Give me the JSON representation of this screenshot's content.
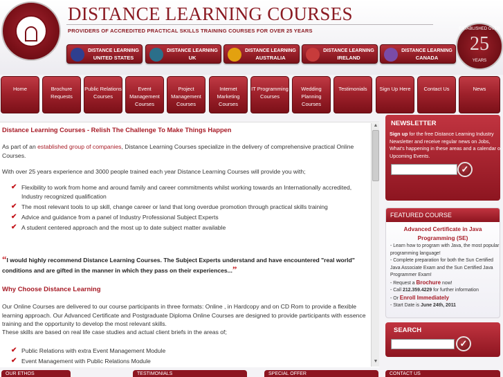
{
  "header": {
    "title": "DISTANCE LEARNING COURSES",
    "tagline": "PROVIDERS OF ACCREDITED PRACTICAL SKILLS TRAINING COURSES FOR OVER 25 YEARS",
    "logo_left_text": "DISTANCE LEARNING COURSES",
    "logo_right": {
      "est": "ESTABLISHED OVER",
      "number": "25",
      "years": "YEARS"
    }
  },
  "regions": [
    {
      "l1": "DISTANCE LEARNING",
      "l2": "UNITED STATES",
      "flag": "us-flag-icon",
      "color": "#2f3f8f"
    },
    {
      "l1": "DISTANCE LEARNING",
      "l2": "UK",
      "flag": "uk-flag-icon",
      "color": "#2b6f8a"
    },
    {
      "l1": "DISTANCE LEARNING",
      "l2": "AUSTRALIA",
      "flag": "australia-flag-icon",
      "color": "#e3a10f"
    },
    {
      "l1": "DISTANCE LEARNING",
      "l2": "IRELAND",
      "flag": "ireland-flag-icon",
      "color": "#c73b3b"
    },
    {
      "l1": "DISTANCE LEARNING",
      "l2": "CANADA",
      "flag": "canada-flag-icon",
      "color": "#7a4ba6"
    }
  ],
  "nav": [
    {
      "label": "Home"
    },
    {
      "label": "Brochure Requests"
    },
    {
      "label": "Public Relations Courses"
    },
    {
      "label": "Event Management Courses"
    },
    {
      "label": "Project Management Courses"
    },
    {
      "label": "Internet Marketing Courses"
    },
    {
      "label": "IT Programming Courses"
    },
    {
      "label": "Wedding Planning Courses"
    },
    {
      "label": "Testimonials"
    },
    {
      "label": "Sign Up Here"
    },
    {
      "label": "Contact Us"
    },
    {
      "label": "News"
    }
  ],
  "main": {
    "heading": "Distance Learning Courses - Relish The Challenge To Make Things Happen",
    "intro_pre": "As part of an ",
    "intro_link": "established group of companies",
    "intro_post": ", Distance Learning Courses specialize in the delivery of comprehensive practical Online Courses.",
    "experience": "With over 25 years experience and 3000 people trained each year Distance Learning Courses will provide you with;",
    "benefits": [
      "Flexibility to work from home and around family and career commitments whilst working towards an Internationally accredited, Industry recognized qualification",
      "The most relevant tools to up skill, change career or land that long overdue promotion through practical skills training",
      "Advice and guidance from a panel of Industry Professional Subject Experts",
      "A student centered approach and the most up to date subject matter available"
    ],
    "quote": "I would highly recommend Distance Learning Courses. The Subject Experts understand and have encountered \"real world\" conditions and are gifted in the manner in which they pass on their experiences...",
    "why_heading": "Why Choose Distance Learning",
    "why_text": "Our Online Courses are delivered to our course participants in three formats: Online , in Hardcopy and on CD Rom to provide a flexible learning approach. Our Advanced Certificate and Postgraduate Diploma Online Courses are designed to provide participants with essence training and the opportunity to develop the most relevant skills.",
    "why_text2": "These skills are based on real life case studies and actual client briefs in the areas of;",
    "areas": [
      "Public Relations with extra Event Management Module",
      "Event Management with Public Relations Module"
    ]
  },
  "sidebar": {
    "newsletter": {
      "heading": "NEWSLETTER",
      "lead": "Sign up",
      "text": " for the free Distance Learning Industry Newsletter and receive regular news on Jobs, What's happening in these areas and a calendar of Upcoming Events."
    },
    "featured": {
      "heading": "FEATURED COURSE",
      "title": "Advanced Certificate in Java Programming (SE)",
      "items": [
        {
          "pre": "- Learn how to program with Java, the most popular programming language!",
          "em": "",
          "post": ""
        },
        {
          "pre": "- Complete preparation for both the Sun Certified Java Associate Exam and the Sun Certified Java Programmer Exam!",
          "em": "",
          "post": ""
        },
        {
          "pre": "- Request a ",
          "em": "Brochure",
          "post": " now!"
        },
        {
          "pre": "- Call ",
          "em": "212.359.4229",
          "post": " for further information"
        },
        {
          "pre": "- Or ",
          "em": "Enroll Immediately",
          "post": ""
        },
        {
          "pre": "- Start Date is ",
          "em": "June 24th, 2011",
          "post": ""
        }
      ]
    },
    "search": {
      "heading": "SEARCH"
    }
  },
  "bottom_tabs": [
    "OUR ETHOS",
    "TESTIMONIALS",
    "SPECIAL OFFER",
    "CONTACT US"
  ]
}
